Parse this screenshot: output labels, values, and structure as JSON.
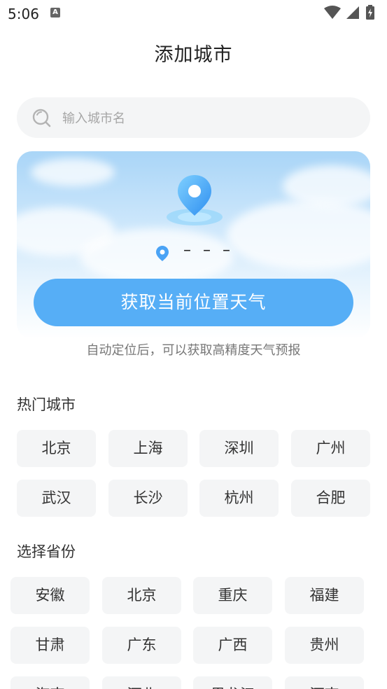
{
  "status_bar": {
    "time": "5:06",
    "notification_icon": "A",
    "icons": [
      "wifi-icon",
      "signal-icon",
      "battery-charging-icon"
    ]
  },
  "page": {
    "title": "添加城市"
  },
  "search": {
    "placeholder": "输入城市名",
    "value": "",
    "icon": "search-icon"
  },
  "locate": {
    "location_text": "– – –",
    "button_label": "获取当前位置天气",
    "hint": "自动定位后，可以获取高精度天气预报",
    "accent_color": "#56aef6"
  },
  "hot_cities": {
    "title": "热门城市",
    "items": [
      "北京",
      "上海",
      "深圳",
      "广州",
      "武汉",
      "长沙",
      "杭州",
      "合肥"
    ]
  },
  "provinces": {
    "title": "选择省份",
    "items": [
      "安徽",
      "北京",
      "重庆",
      "福建",
      "甘肃",
      "广东",
      "广西",
      "贵州",
      "海南",
      "河北",
      "黑龙江",
      "河南"
    ]
  }
}
